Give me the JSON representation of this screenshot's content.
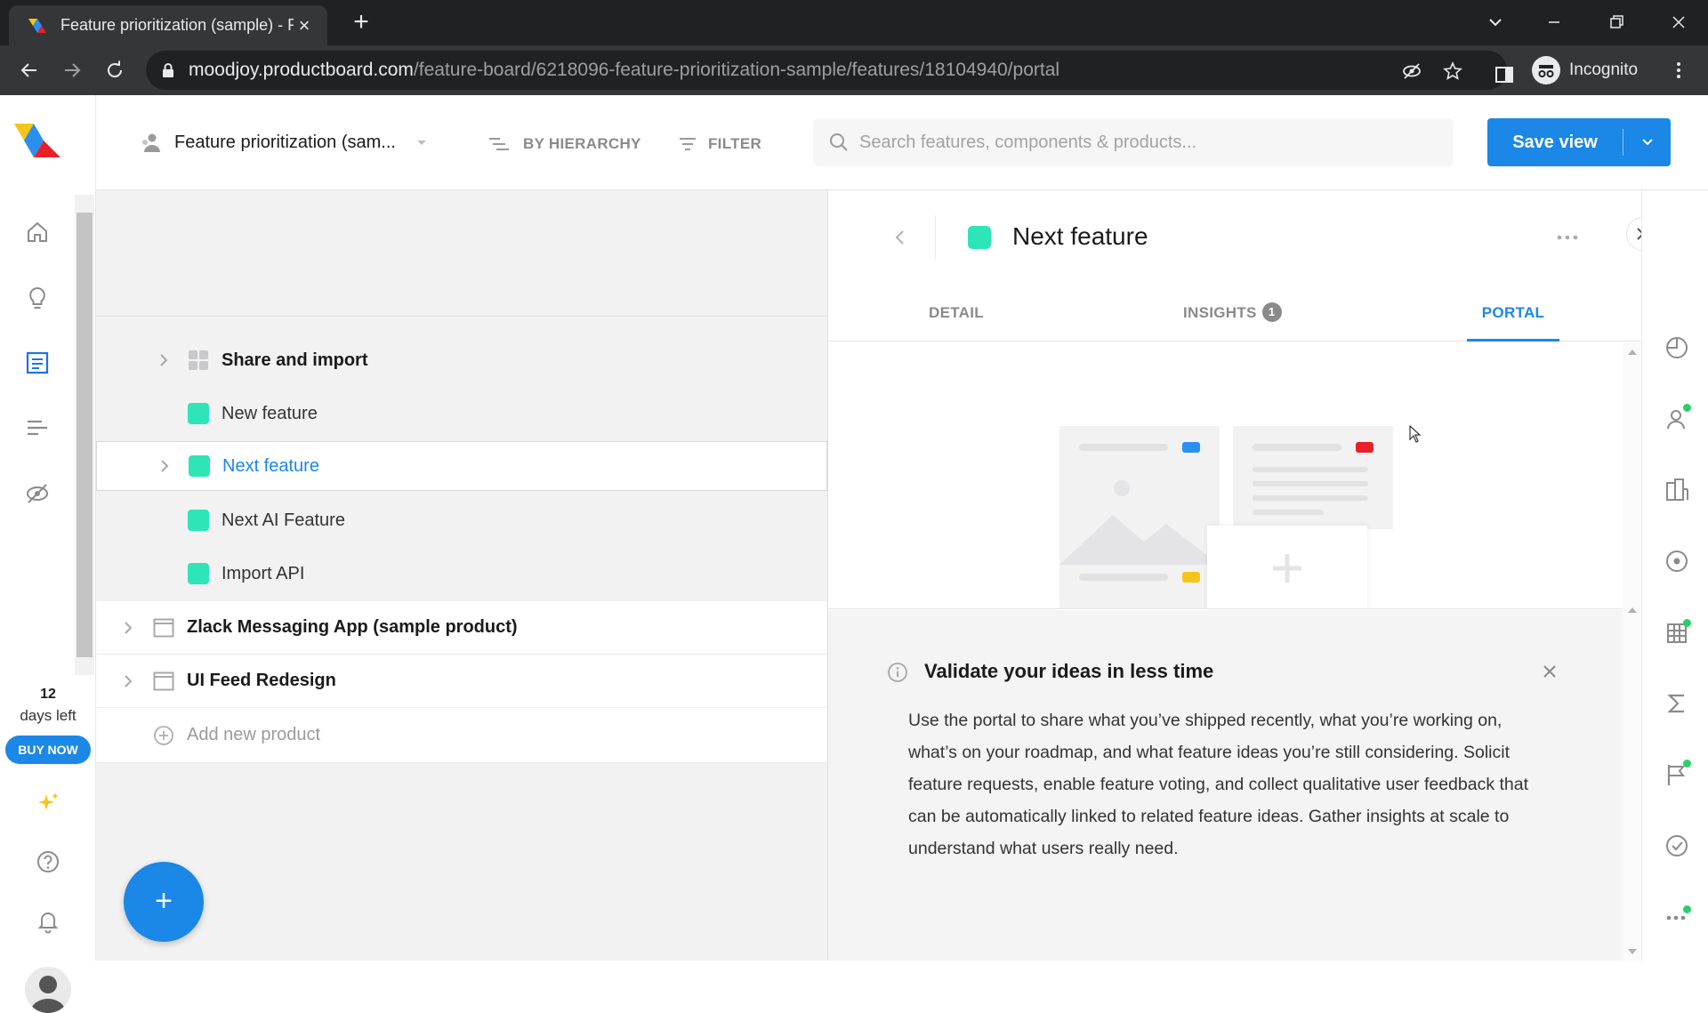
{
  "browser": {
    "tab_title": "Feature prioritization (sample) - P",
    "url_host": "moodjoy.productboard.com",
    "url_path": "/feature-board/6218096-feature-prioritization-sample/features/18104940/portal",
    "profile_label": "Incognito"
  },
  "nav": {
    "trial_days": "12",
    "trial_text": "days left",
    "buy_now": "BUY NOW"
  },
  "toolbar": {
    "board_name": "Feature prioritization (sam...",
    "by_hierarchy": "BY HIERARCHY",
    "filter": "FILTER",
    "search_placeholder": "Search features, components & products...",
    "save_view": "Save view"
  },
  "list": {
    "rows": [
      {
        "label": "Share and import",
        "kind": "component"
      },
      {
        "label": "New feature",
        "kind": "feature"
      },
      {
        "label": "Next feature",
        "kind": "feature",
        "selected": true
      },
      {
        "label": "Next AI Feature",
        "kind": "feature"
      },
      {
        "label": "Import API",
        "kind": "feature"
      },
      {
        "label": "Zlack Messaging App (sample product)",
        "kind": "product"
      },
      {
        "label": "UI Feed Redesign",
        "kind": "product"
      }
    ],
    "add_product": "Add new product"
  },
  "panel": {
    "title": "Next feature",
    "tabs": [
      {
        "label": "DETAIL"
      },
      {
        "label": "INSIGHTS",
        "badge": "1"
      },
      {
        "label": "PORTAL",
        "active": true
      }
    ],
    "info": {
      "title": "Validate your ideas in less time",
      "body": "Use the portal to share what you’ve shipped recently, what you’re working on, what’s on your roadmap, and what feature ideas you’re still considering. Solicit feature requests, enable feature voting, and collect qualitative user feedback that can be automatically linked to related feature ideas. Gather insights at scale to understand what users really need."
    }
  },
  "colors": {
    "accent": "#1b87e6",
    "feature_swatch": "#2ee5b8",
    "illustration_blue": "#2b8ff0",
    "illustration_red": "#e8202a",
    "illustration_yellow": "#f5c518"
  }
}
